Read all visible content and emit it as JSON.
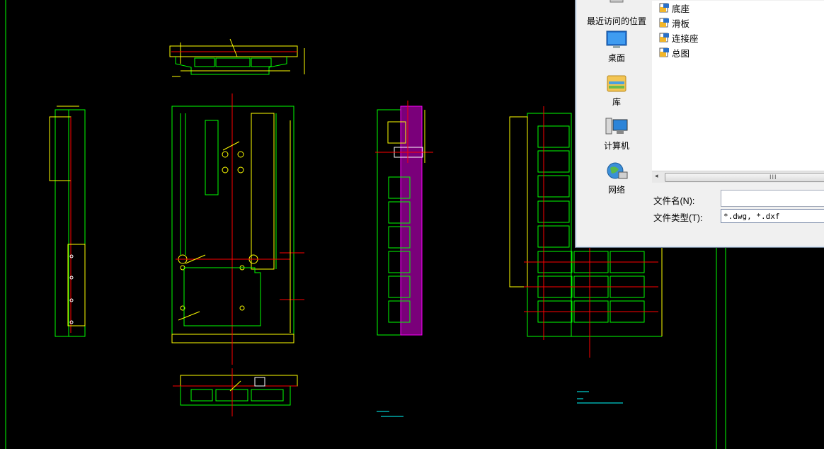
{
  "dialog": {
    "places": [
      {
        "label": "最近访问的位置",
        "icon": "recent-places-icon"
      },
      {
        "label": "桌面",
        "icon": "desktop-icon"
      },
      {
        "label": "库",
        "icon": "libraries-icon"
      },
      {
        "label": "计算机",
        "icon": "computer-icon"
      },
      {
        "label": "网络",
        "icon": "network-icon"
      }
    ],
    "files": [
      {
        "name": "底座",
        "icon": "dwg-file-icon"
      },
      {
        "name": "滑板",
        "icon": "dwg-file-icon"
      },
      {
        "name": "连接座",
        "icon": "dwg-file-icon"
      },
      {
        "name": "总图",
        "icon": "dwg-file-icon"
      }
    ],
    "scroll_grip": "III",
    "filename_label": "文件名(N):",
    "filename_value": "",
    "filetype_label": "文件类型(T):",
    "filetype_value": "*.dwg, *.dxf"
  },
  "colors": {
    "cad_background": "#000000",
    "outline": "#00ff00",
    "center_line": "#ff0000",
    "dimension": "#ffff00",
    "hatch": "#cc00cc",
    "notes": "#00ffff"
  }
}
